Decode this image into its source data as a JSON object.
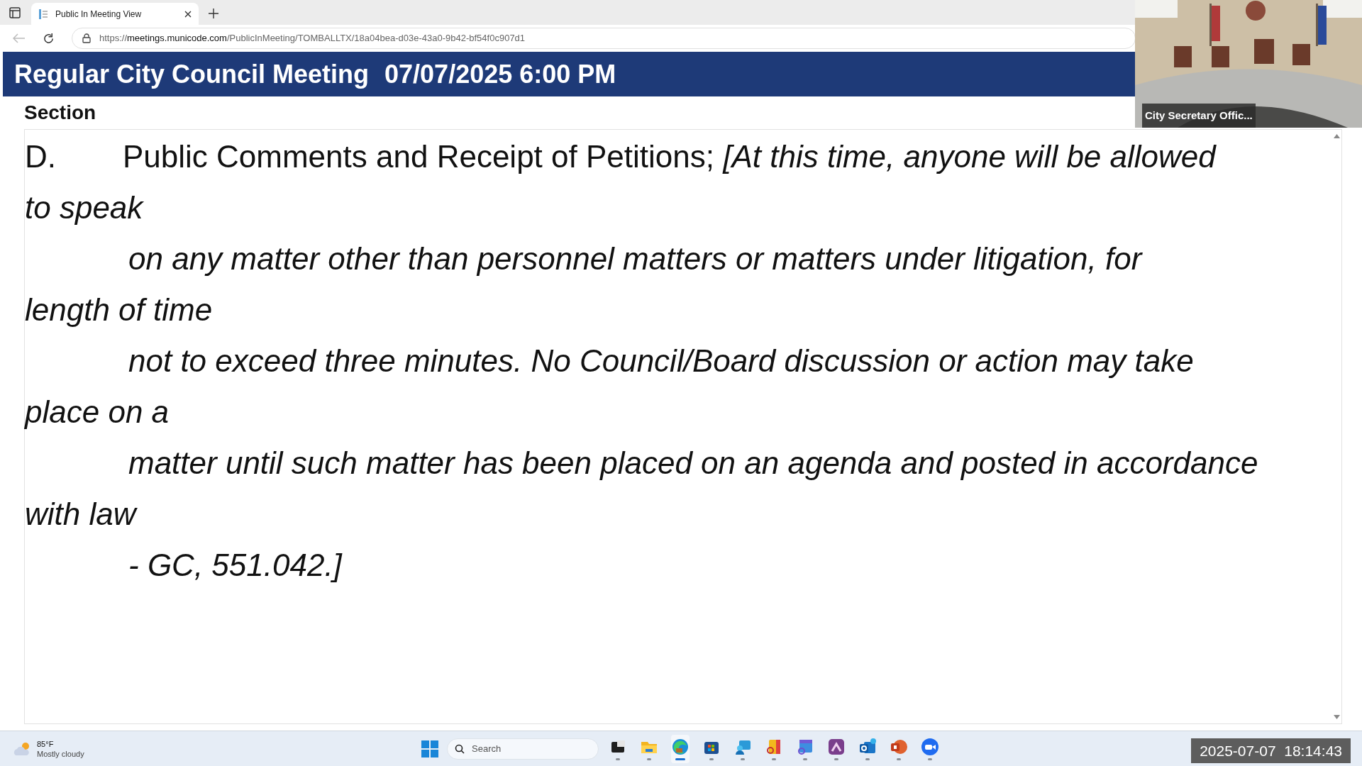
{
  "browser": {
    "tab": {
      "title": "Public In Meeting View",
      "selected": true
    },
    "url": {
      "scheme": "https://",
      "host": "meetings.municode.com",
      "path": "/PublicInMeeting/TOMBALLTX/18a04bea-d03e-43a0-9b42-bf54f0c907d1"
    }
  },
  "banner": {
    "title": "Regular City Council Meeting",
    "date_time": "07/07/2025 6:00 PM"
  },
  "section": {
    "label": "Section",
    "item": {
      "number": "D.",
      "title": "Public Comments and Receipt of Petitions;",
      "lines": [
        {
          "text": "[At this time, anyone will be allowed",
          "indented": false
        },
        {
          "text": "to speak",
          "indented": false
        },
        {
          "text": "on any matter other than personnel matters or matters under litigation, for",
          "indented": true
        },
        {
          "text": "length of time",
          "indented": false
        },
        {
          "text": "not to exceed three minutes. No Council/Board discussion or action may take",
          "indented": true
        },
        {
          "text": "place on a",
          "indented": false
        },
        {
          "text": "matter until such matter has been placed on an agenda and posted in accordance",
          "indented": true
        },
        {
          "text": "with law",
          "indented": false
        },
        {
          "text": "- GC, 551.042.]",
          "indented": true
        }
      ]
    }
  },
  "video": {
    "kind": "picture",
    "caption": "City Secretary Offic..."
  },
  "taskbar": {
    "weather": {
      "temperature": "85°F",
      "condition": "Mostly cloudy"
    },
    "search": {
      "placeholder": "Search"
    },
    "apps": [
      {
        "kind": "taskview",
        "active": false
      },
      {
        "kind": "folder",
        "active": false
      },
      {
        "kind": "edge",
        "active": true
      },
      {
        "kind": "store",
        "active": false
      },
      {
        "kind": "people",
        "active": false
      },
      {
        "kind": "docsearch",
        "active": false
      },
      {
        "kind": "calsearch",
        "active": false
      },
      {
        "kind": "purple",
        "active": false
      },
      {
        "kind": "mail",
        "active": false
      },
      {
        "kind": "slides",
        "active": false
      },
      {
        "kind": "video",
        "active": false
      }
    ]
  },
  "timestamp": "2025-07-07  18:14:43"
}
